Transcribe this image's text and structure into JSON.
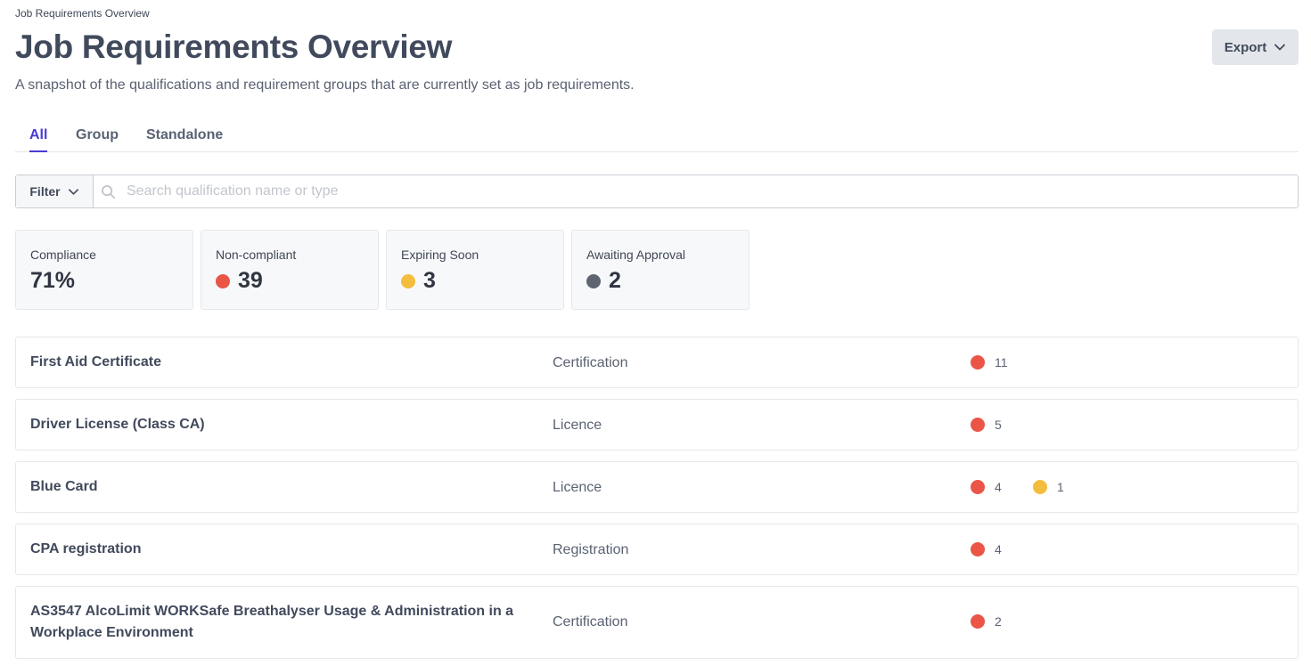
{
  "breadcrumb": "Job Requirements Overview",
  "title": "Job Requirements Overview",
  "subtitle": "A snapshot of the qualifications and requirement groups that are currently set as job requirements.",
  "export_label": "Export",
  "tabs": [
    {
      "label": "All",
      "active": true
    },
    {
      "label": "Group",
      "active": false
    },
    {
      "label": "Standalone",
      "active": false
    }
  ],
  "filter_label": "Filter",
  "search": {
    "placeholder": "Search qualification name or type",
    "value": ""
  },
  "stats": [
    {
      "label": "Compliance",
      "value": "71%",
      "status": "none"
    },
    {
      "label": "Non-compliant",
      "value": "39",
      "status": "red"
    },
    {
      "label": "Expiring Soon",
      "value": "3",
      "status": "yellow"
    },
    {
      "label": "Awaiting Approval",
      "value": "2",
      "status": "gray"
    }
  ],
  "colors": {
    "accent": "#4a3ad4",
    "red": "#ea5547",
    "yellow": "#f5bd3d",
    "gray": "#5e6570"
  },
  "rows": [
    {
      "name": "First Aid Certificate",
      "type": "Certification",
      "noncompliant": "11",
      "expiring": ""
    },
    {
      "name": "Driver License (Class CA)",
      "type": "Licence",
      "noncompliant": "5",
      "expiring": ""
    },
    {
      "name": "Blue Card",
      "type": "Licence",
      "noncompliant": "4",
      "expiring": "1"
    },
    {
      "name": "CPA registration",
      "type": "Registration",
      "noncompliant": "4",
      "expiring": ""
    },
    {
      "name": "AS3547 AlcoLimit WORKSafe Breathalyser Usage & Administration in a Workplace Environment",
      "type": "Certification",
      "noncompliant": "2",
      "expiring": ""
    }
  ]
}
